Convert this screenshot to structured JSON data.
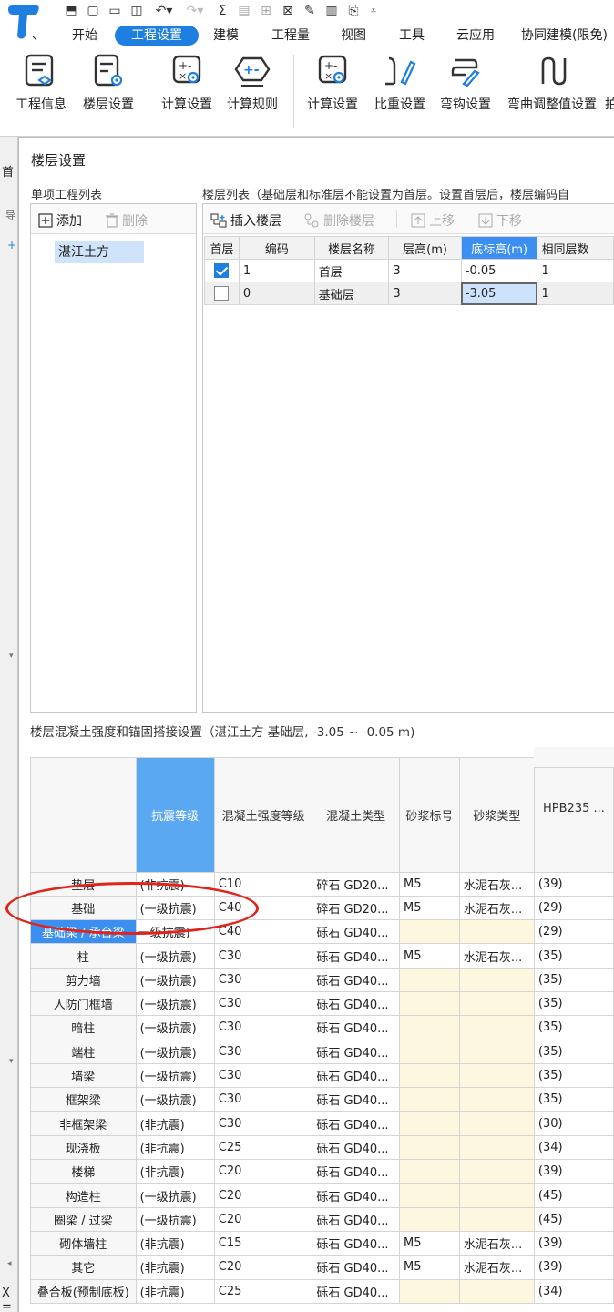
{
  "menu_tabs": [
    "开始",
    "工程设置",
    "建模",
    "工程量",
    "视图",
    "工具",
    "云应用",
    "协同建模(限免)"
  ],
  "active_tab": "工程设置",
  "ribbon": [
    "工程信息",
    "楼层设置",
    "计算设置",
    "计算规则",
    "计算设置",
    "比重设置",
    "弯钩设置",
    "弯曲调整值设置",
    "拍"
  ],
  "colors": {
    "accent": "#1f7fe0",
    "header_selected": "#3b8ff0",
    "header_blue": "#5aa7f2",
    "mortar_cell": "#fdf7e0",
    "annotation": "#e2231a"
  },
  "dialog": {
    "title": "楼层设置",
    "project_list_title": "单项工程列表",
    "add_label": "添加",
    "delete_label": "删除",
    "project_item": "湛江土方",
    "floor_list_title": "楼层列表（基础层和标准层不能设置为首层。设置首层后，楼层编码自",
    "insert_floor": "插入楼层",
    "delete_floor": "删除楼层",
    "move_up": "上移",
    "move_down": "下移",
    "floor_headers": [
      "首层",
      "编码",
      "楼层名称",
      "层高(m)",
      "底标高(m)",
      "相同层数"
    ],
    "floors": [
      {
        "first": true,
        "code": "1",
        "name": "首层",
        "height": "3",
        "bottom": "-0.05",
        "same": "1"
      },
      {
        "first": false,
        "code": "0",
        "name": "基础层",
        "height": "3",
        "bottom": "-3.05",
        "same": "1"
      }
    ],
    "concrete_title": "楼层混凝土强度和锚固搭接设置（湛江土方  基础层, -3.05 ~ -0.05 m)",
    "concrete_headers": [
      "抗震等级",
      "混凝土强度等级",
      "混凝土类型",
      "砂浆标号",
      "砂浆类型",
      "HPB235 ..."
    ],
    "concrete_rows": [
      {
        "name": "垫层",
        "seismic": "(非抗震)",
        "grade": "C10",
        "ctype": "碎石 GD20...",
        "mortar": "M5",
        "mtype": "水泥石灰...",
        "hpb": "(39)"
      },
      {
        "name": "基础",
        "seismic": "(一级抗震)",
        "grade": "C40",
        "ctype": "碎石 GD20...",
        "mortar": "M5",
        "mtype": "水泥石灰...",
        "hpb": "(29)"
      },
      {
        "name": "基础梁 / 承台梁",
        "seismic": "一级抗震)",
        "grade": "C40",
        "ctype": "砾石 GD40...",
        "mortar": "",
        "mtype": "",
        "hpb": "(29)"
      },
      {
        "name": "柱",
        "seismic": "(一级抗震)",
        "grade": "C30",
        "ctype": "砾石 GD40...",
        "mortar": "M5",
        "mtype": "水泥石灰...",
        "hpb": "(35)"
      },
      {
        "name": "剪力墙",
        "seismic": "(一级抗震)",
        "grade": "C30",
        "ctype": "砾石 GD40...",
        "mortar": "",
        "mtype": "",
        "hpb": "(35)"
      },
      {
        "name": "人防门框墙",
        "seismic": "(一级抗震)",
        "grade": "C30",
        "ctype": "砾石 GD40...",
        "mortar": "",
        "mtype": "",
        "hpb": "(35)"
      },
      {
        "name": "暗柱",
        "seismic": "(一级抗震)",
        "grade": "C30",
        "ctype": "砾石 GD40...",
        "mortar": "",
        "mtype": "",
        "hpb": "(35)"
      },
      {
        "name": "端柱",
        "seismic": "(一级抗震)",
        "grade": "C30",
        "ctype": "砾石 GD40...",
        "mortar": "",
        "mtype": "",
        "hpb": "(35)"
      },
      {
        "name": "墙梁",
        "seismic": "(一级抗震)",
        "grade": "C30",
        "ctype": "砾石 GD40...",
        "mortar": "",
        "mtype": "",
        "hpb": "(35)"
      },
      {
        "name": "框架梁",
        "seismic": "(一级抗震)",
        "grade": "C30",
        "ctype": "砾石 GD40...",
        "mortar": "",
        "mtype": "",
        "hpb": "(35)"
      },
      {
        "name": "非框架梁",
        "seismic": "(非抗震)",
        "grade": "C30",
        "ctype": "砾石 GD40...",
        "mortar": "",
        "mtype": "",
        "hpb": "(30)"
      },
      {
        "name": "现浇板",
        "seismic": "(非抗震)",
        "grade": "C25",
        "ctype": "砾石 GD40...",
        "mortar": "",
        "mtype": "",
        "hpb": "(34)"
      },
      {
        "name": "楼梯",
        "seismic": "(非抗震)",
        "grade": "C20",
        "ctype": "砾石 GD40...",
        "mortar": "",
        "mtype": "",
        "hpb": "(39)"
      },
      {
        "name": "构造柱",
        "seismic": "(一级抗震)",
        "grade": "C20",
        "ctype": "砾石 GD40...",
        "mortar": "",
        "mtype": "",
        "hpb": "(45)"
      },
      {
        "name": "圈梁 / 过梁",
        "seismic": "(一级抗震)",
        "grade": "C20",
        "ctype": "砾石 GD40...",
        "mortar": "",
        "mtype": "",
        "hpb": "(45)"
      },
      {
        "name": "砌体墙柱",
        "seismic": "(非抗震)",
        "grade": "C15",
        "ctype": "砾石 GD40...",
        "mortar": "M5",
        "mtype": "水泥石灰...",
        "hpb": "(39)"
      },
      {
        "name": "其它",
        "seismic": "(非抗震)",
        "grade": "C20",
        "ctype": "砾石 GD40...",
        "mortar": "M5",
        "mtype": "水泥石灰...",
        "hpb": "(39)"
      },
      {
        "name": "叠合板(预制底板)",
        "seismic": "(非抗震)",
        "grade": "C25",
        "ctype": "砾石 GD40...",
        "mortar": "",
        "mtype": "",
        "hpb": "(34)"
      }
    ],
    "selected_row": 2
  },
  "left_strip": [
    "首",
    "导",
    "+",
    "X ="
  ]
}
